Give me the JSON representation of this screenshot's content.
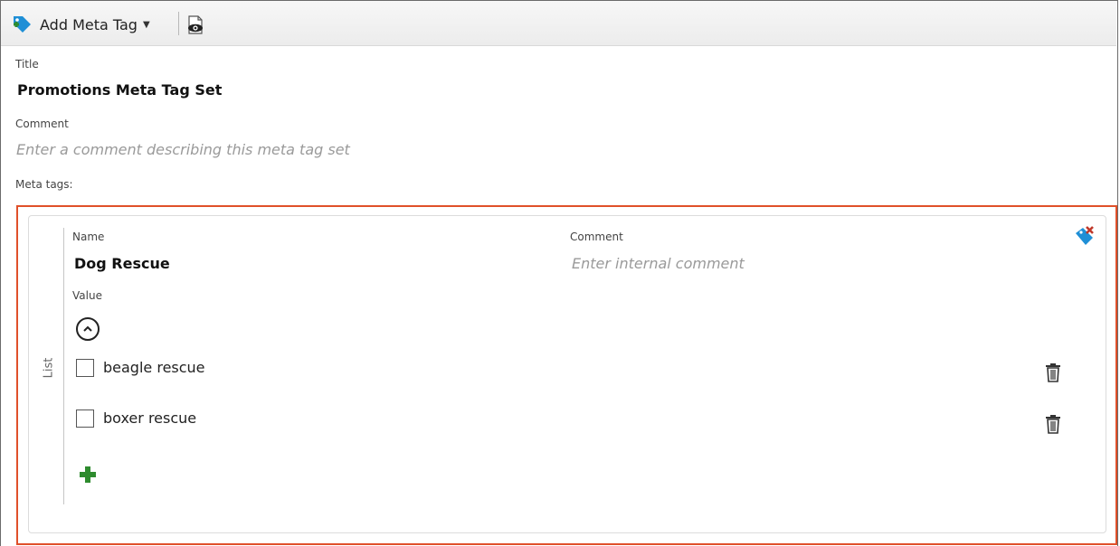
{
  "toolbar": {
    "add_meta_tag_label": "Add Meta Tag",
    "add_icon": "tag-plus-icon",
    "dropdown_icon": "caret-down-icon",
    "preview_icon": "preview-eye-icon"
  },
  "form": {
    "title_label": "Title",
    "title_value": "Promotions Meta Tag Set",
    "comment_label": "Comment",
    "comment_placeholder": "Enter a comment describing this meta tag set",
    "meta_tags_label": "Meta tags:"
  },
  "meta_tag": {
    "type_label": "List",
    "name_label": "Name",
    "name_value": "Dog Rescue",
    "comment_label": "Comment",
    "comment_placeholder": "Enter internal comment",
    "value_label": "Value",
    "collapse_icon": "chevron-up-circle-icon",
    "delete_tag_icon": "tag-delete-icon",
    "items": [
      {
        "label": "beagle rescue",
        "checked": false
      },
      {
        "label": "boxer rescue",
        "checked": false
      }
    ],
    "add_value_icon": "plus-icon"
  },
  "colors": {
    "highlight_border": "#e0502a",
    "add_green": "#2e8b2e",
    "tag_blue": "#1f8fd6"
  }
}
